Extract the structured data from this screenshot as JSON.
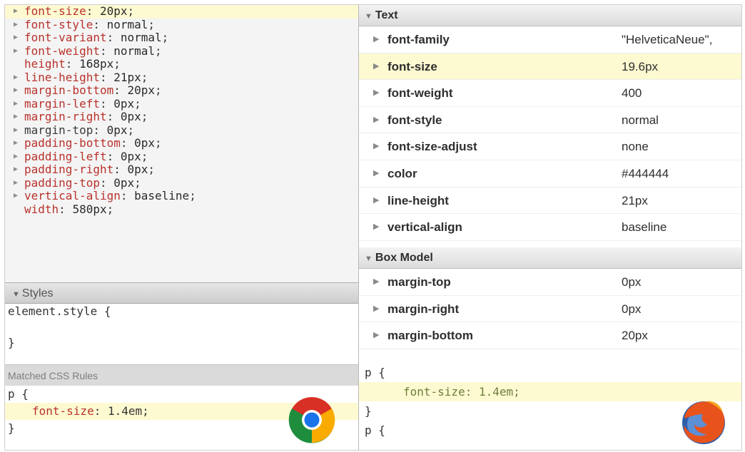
{
  "chrome": {
    "computed_lines": [
      {
        "name": "font-size",
        "value": "20px",
        "arrow": true,
        "highlight": true,
        "name_color": "red"
      },
      {
        "name": "font-style",
        "value": "normal",
        "arrow": true,
        "name_color": "red"
      },
      {
        "name": "font-variant",
        "value": "normal",
        "arrow": true,
        "name_color": "red"
      },
      {
        "name": "font-weight",
        "value": "normal",
        "arrow": true,
        "name_color": "red"
      },
      {
        "name": "height",
        "value": "168px",
        "arrow": false,
        "name_color": "red"
      },
      {
        "name": "line-height",
        "value": "21px",
        "arrow": true,
        "name_color": "red"
      },
      {
        "name": "margin-bottom",
        "value": "20px",
        "arrow": true,
        "name_color": "red"
      },
      {
        "name": "margin-left",
        "value": "0px",
        "arrow": true,
        "name_color": "red"
      },
      {
        "name": "margin-right",
        "value": "0px",
        "arrow": true,
        "name_color": "red"
      },
      {
        "name": "margin-top",
        "value": "0px",
        "arrow": true,
        "name_color": "dark"
      },
      {
        "name": "padding-bottom",
        "value": "0px",
        "arrow": true,
        "name_color": "red"
      },
      {
        "name": "padding-left",
        "value": "0px",
        "arrow": true,
        "name_color": "red"
      },
      {
        "name": "padding-right",
        "value": "0px",
        "arrow": true,
        "name_color": "red"
      },
      {
        "name": "padding-top",
        "value": "0px",
        "arrow": true,
        "name_color": "red"
      },
      {
        "name": "vertical-align",
        "value": "baseline",
        "arrow": true,
        "name_color": "red"
      },
      {
        "name": "width",
        "value": "580px",
        "arrow": false,
        "name_color": "red"
      }
    ],
    "styles_label": "Styles",
    "element_style_open": "element.style {",
    "element_style_close": "}",
    "matched_label": "Matched CSS Rules",
    "rule_open": "p {",
    "rule_decl_name": "font-size",
    "rule_decl_value": "1.4em;",
    "rule_close": "}",
    "logo": "chrome-logo"
  },
  "firefox": {
    "text_group": "Text",
    "text_rows": [
      {
        "name": "font-family",
        "value": "\"HelveticaNeue\",",
        "highlight": false
      },
      {
        "name": "font-size",
        "value": "19.6px",
        "highlight": true
      },
      {
        "name": "font-weight",
        "value": "400",
        "highlight": false
      },
      {
        "name": "font-style",
        "value": "normal",
        "highlight": false
      },
      {
        "name": "font-size-adjust",
        "value": "none",
        "highlight": false
      },
      {
        "name": "color",
        "value": "#444444",
        "highlight": false
      },
      {
        "name": "line-height",
        "value": "21px",
        "highlight": false
      },
      {
        "name": "vertical-align",
        "value": "baseline",
        "highlight": false
      }
    ],
    "box_group": "Box Model",
    "box_rows": [
      {
        "name": "margin-top",
        "value": "0px"
      },
      {
        "name": "margin-right",
        "value": "0px"
      },
      {
        "name": "margin-bottom",
        "value": "20px"
      }
    ],
    "rule_open": "p {",
    "rule_decl": "font-size: 1.4em;",
    "rule_close": "}",
    "rule2_open": "p {",
    "logo": "firefox-logo"
  },
  "colors": {
    "highlight": "#fdfad1",
    "property_red": "#b8322c",
    "firefox_value": "#6e7d3c"
  }
}
